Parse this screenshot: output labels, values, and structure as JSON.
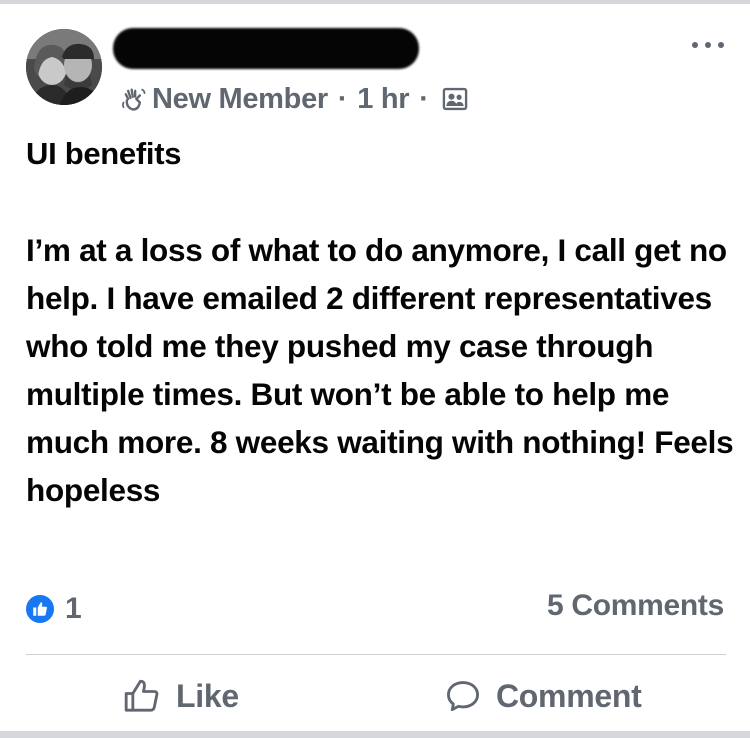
{
  "post": {
    "badge": "New Member",
    "separator": "·",
    "time": "1 hr",
    "title": "UI benefits",
    "body": "I’m at a loss of what to do anymore, I call get no help. I have emailed 2 different representatives who told me they pushed my case through multiple times. But won’t be able to help me much more. 8 weeks waiting with nothing! Feels hopeless"
  },
  "engagement": {
    "reaction_count": "1",
    "comments": "5 Comments"
  },
  "actions": {
    "like_label": "Like",
    "comment_label": "Comment"
  },
  "icons": {
    "more": "more-dots-icon",
    "badge": "waving-hand-icon",
    "audience": "group-members-icon",
    "reaction": "thumbs-up-icon",
    "like": "thumbs-up-outline-icon",
    "comment": "speech-bubble-icon"
  },
  "colors": {
    "text": "#050505",
    "secondary_text": "#606770",
    "like_blue": "#1877f2",
    "divider": "#d0d2d6"
  }
}
